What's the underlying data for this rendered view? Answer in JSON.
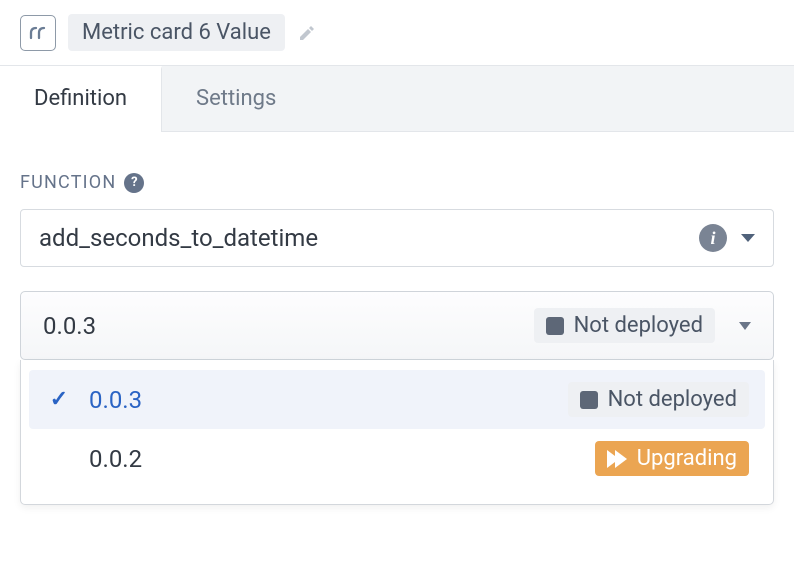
{
  "header": {
    "title": "Metric card 6 Value"
  },
  "tabs": [
    {
      "label": "Definition",
      "active": true
    },
    {
      "label": "Settings",
      "active": false
    }
  ],
  "function": {
    "section_label": "FUNCTION",
    "name": "add_seconds_to_datetime"
  },
  "version": {
    "current": "0.0.3",
    "current_status_label": "Not deployed",
    "options": [
      {
        "label": "0.0.3",
        "selected": true,
        "status": "not-deployed",
        "status_label": "Not deployed"
      },
      {
        "label": "0.0.2",
        "selected": false,
        "status": "upgrading",
        "status_label": "Upgrading"
      }
    ]
  }
}
